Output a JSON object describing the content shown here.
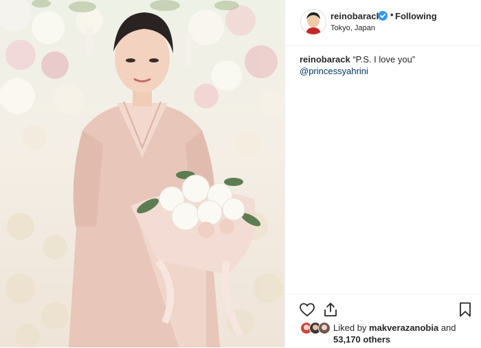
{
  "post": {
    "username": "reinobarack",
    "follow_status": "Following",
    "location": "Tokyo, Japan",
    "caption_user": "reinobarack",
    "caption_text": "“P.S. I love you”",
    "caption_mention": "@princessyahrini"
  },
  "likes": {
    "prefix": "Liked by ",
    "liker": "makverazanobia",
    "joiner": " and",
    "others": "53,170 others"
  },
  "icons": [
    "heart-icon",
    "share-icon",
    "bookmark-icon",
    "verified-badge-icon"
  ],
  "colors": {
    "verified": "#3897f0",
    "link": "#003569",
    "text": "#262626"
  }
}
